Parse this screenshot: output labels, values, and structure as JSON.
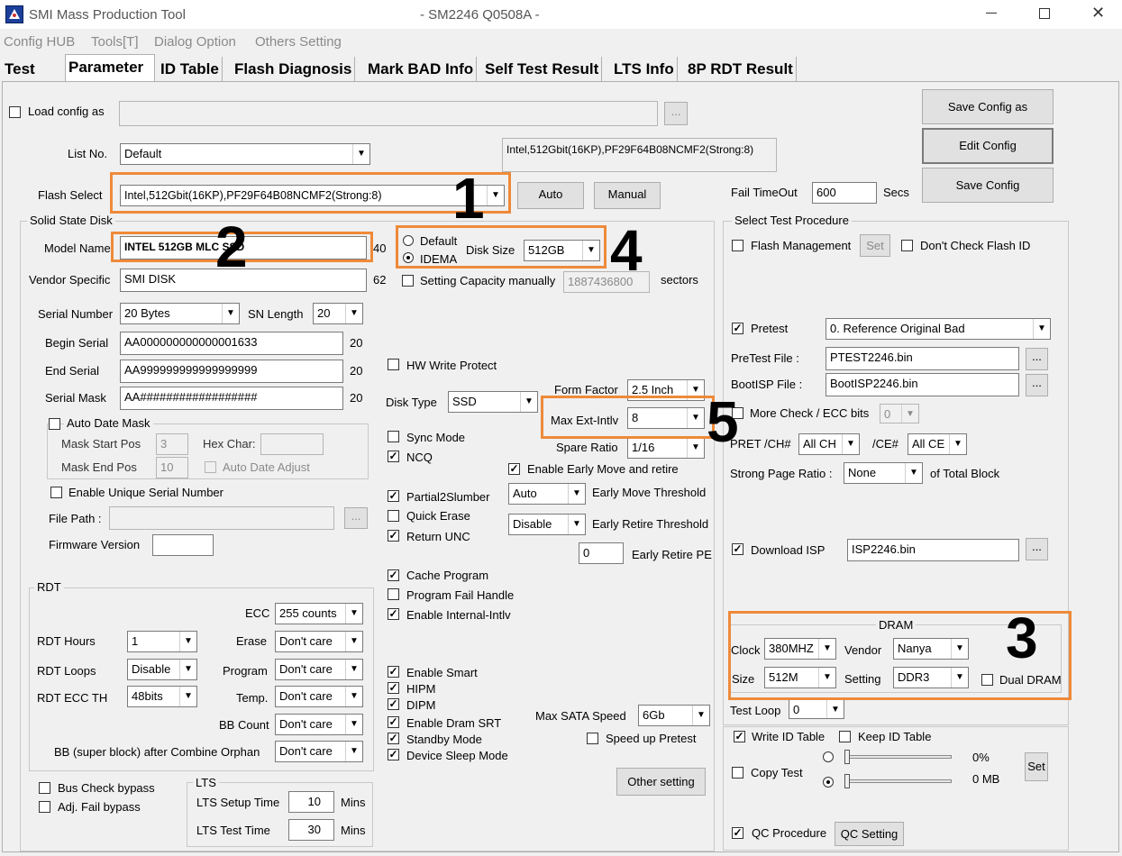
{
  "window": {
    "app_title": "SMI Mass Production Tool",
    "center_title": "- SM2246 Q0508A -"
  },
  "menu": [
    "Config HUB",
    "Tools[T]",
    "Dialog Option",
    "Others Setting"
  ],
  "tabs": [
    "Test",
    "Parameter",
    "ID Table",
    "Flash Diagnosis",
    "Mark BAD Info",
    "Self Test Result",
    "LTS Info",
    "8P RDT Result"
  ],
  "config": {
    "load_config_label": "Load config as",
    "browse": "...",
    "list_no_label": "List No.",
    "list_no_value": "Default",
    "flash_info": "Intel,512Gbit(16KP),PF29F64B08NCMF2(Strong:8)",
    "flash_select_label": "Flash Select",
    "flash_select_value": "Intel,512Gbit(16KP),PF29F64B08NCMF2(Strong:8)",
    "auto_button": "Auto",
    "manual_button": "Manual",
    "save_config_as": "Save Config as",
    "edit_config": "Edit Config",
    "save_config": "Save Config",
    "fail_timeout_label": "Fail TimeOut",
    "fail_timeout_value": "600",
    "secs": "Secs"
  },
  "ssd": {
    "group_title": "Solid State Disk",
    "model_name_label": "Model Name",
    "model_name_value": "INTEL 512GB MLC SSD",
    "model_name_len": "40",
    "vendor_label": "Vendor Specific",
    "vendor_value": "SMI DISK",
    "vendor_len": "62",
    "serial_number_label": "Serial Number",
    "serial_number_value": "20 Bytes",
    "sn_length_label": "SN Length",
    "sn_length_value": "20",
    "begin_serial_label": "Begin Serial",
    "begin_serial_value": "AA000000000000001633",
    "begin_serial_len": "20",
    "end_serial_label": "End Serial",
    "end_serial_value": "AA999999999999999999",
    "end_serial_len": "20",
    "serial_mask_label": "Serial Mask",
    "serial_mask_value": "AA##################",
    "serial_mask_len": "20",
    "auto_date_mask": "Auto Date Mask",
    "mask_start_pos": "Mask Start Pos",
    "mask_start_val": "3",
    "hex_char": "Hex Char:",
    "mask_end_pos": "Mask End Pos",
    "mask_end_val": "10",
    "auto_date_adjust": "Auto Date Adjust",
    "enable_unique_sn": "Enable Unique Serial Number",
    "file_path_label": "File Path :",
    "firmware_version_label": "Firmware Version"
  },
  "capacity": {
    "default": "Default",
    "idema": "IDEMA",
    "disk_size_label": "Disk Size",
    "disk_size_value": "512GB",
    "setting_capacity": "Setting Capacity manually",
    "sectors_value": "1887436800",
    "sectors": "sectors"
  },
  "options": {
    "hw_write_protect": "HW Write Protect",
    "disk_type_label": "Disk Type",
    "disk_type_value": "SSD",
    "form_factor_label": "Form Factor",
    "form_factor_value": "2.5 Inch",
    "max_ext_intlv_label": "Max Ext-Intlv",
    "max_ext_intlv_value": "8",
    "spare_ratio_label": "Spare Ratio",
    "spare_ratio_value": "1/16",
    "sync_mode": "Sync Mode",
    "ncq": "NCQ",
    "enable_early_move": "Enable Early Move and retire",
    "partial2slumber": "Partial2Slumber",
    "early_move_value": "Auto",
    "early_move_threshold": "Early Move Threshold",
    "quick_erase": "Quick Erase",
    "early_retire_value": "Disable",
    "early_retire_threshold": "Early Retire Threshold",
    "return_unc": "Return UNC",
    "early_retire_pe_value": "0",
    "early_retire_pe": "Early Retire PE",
    "cache_program": "Cache Program",
    "program_fail_handle": "Program Fail Handle",
    "enable_internal_intlv": "Enable Internal-Intlv",
    "enable_smart": "Enable Smart",
    "hipm": "HIPM",
    "dipm": "DIPM",
    "enable_dram_srt": "Enable Dram SRT",
    "standby_mode": "Standby Mode",
    "device_sleep_mode": "Device Sleep Mode",
    "max_sata_speed_label": "Max SATA Speed",
    "max_sata_speed_value": "6Gb",
    "speed_up_pretest": "Speed up Pretest",
    "other_setting": "Other setting"
  },
  "rdt": {
    "group_title": "RDT",
    "ecc_label": "ECC",
    "ecc_value": "255 counts",
    "rdt_hours_label": "RDT Hours",
    "rdt_hours_value": "1",
    "erase_label": "Erase",
    "erase_value": "Don't care",
    "rdt_loops_label": "RDT Loops",
    "rdt_loops_value": "Disable",
    "program_label": "Program",
    "program_value": "Don't care",
    "rdt_ecc_th_label": "RDT ECC TH",
    "rdt_ecc_th_value": "48bits",
    "temp_label": "Temp.",
    "temp_value": "Don't care",
    "bb_count_label": "BB Count",
    "bb_count_value": "Don't care",
    "bb_orphan_label": "BB (super block) after Combine Orphan",
    "bb_orphan_value": "Don't care"
  },
  "bypass": {
    "bus_check": "Bus Check bypass",
    "adj_fail": "Adj. Fail bypass"
  },
  "lts": {
    "group_title": "LTS",
    "setup_time_label": "LTS Setup Time",
    "setup_time_value": "10",
    "test_time_label": "LTS Test Time",
    "test_time_value": "30",
    "mins": "Mins"
  },
  "procedure": {
    "group_title": "Select Test Procedure",
    "flash_management": "Flash Management",
    "set": "Set",
    "dont_check_flash_id": "Don't Check Flash ID",
    "pretest": "Pretest",
    "pretest_value": "0. Reference Original Bad",
    "pretest_file_label": "PreTest File :",
    "pretest_file_value": "PTEST2246.bin",
    "bootisp_file_label": "BootISP File :",
    "bootisp_file_value": "BootISP2246.bin",
    "more_check": "More Check / ECC bits",
    "more_check_value": "0",
    "pret_ch_label": "PRET /CH#",
    "pret_ch_value": "All CH",
    "ce_label": "/CE#",
    "ce_value": "All CE",
    "strong_page_ratio": "Strong Page Ratio :",
    "strong_page_value": "None",
    "of_total_block": "of Total Block",
    "download_isp": "Download ISP",
    "isp_value": "ISP2246.bin"
  },
  "dram": {
    "group_title": "DRAM",
    "clock_label": "Clock",
    "clock_value": "380MHZ",
    "vendor_label": "Vendor",
    "vendor_value": "Nanya",
    "size_label": "Size",
    "size_value": "512M",
    "setting_label": "Setting",
    "setting_value": "DDR3",
    "dual_dram": "Dual DRAM"
  },
  "bottom": {
    "test_loop_label": "Test Loop",
    "test_loop_value": "0",
    "write_id_table": "Write ID Table",
    "keep_id_table": "Keep ID Table",
    "copy_test": "Copy Test",
    "percent": "0%",
    "mb": "0 MB",
    "set": "Set",
    "qc_procedure": "QC Procedure",
    "qc_setting": "QC Setting"
  },
  "annotations": [
    "1",
    "2",
    "3",
    "4",
    "5"
  ],
  "colors": {
    "highlight": "#ee8a3a"
  }
}
